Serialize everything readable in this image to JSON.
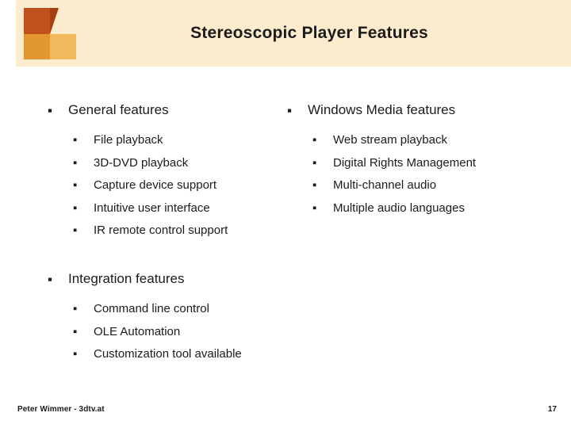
{
  "slide": {
    "title": "Stereoscopic Player Features",
    "sections": [
      {
        "heading": "General features",
        "items": [
          "File playback",
          "3D-DVD playback",
          "Capture device support",
          "Intuitive user interface",
          "IR remote control support"
        ]
      },
      {
        "heading": "Windows Media features",
        "items": [
          "Web stream playback",
          "Digital Rights Management",
          "Multi-channel audio",
          "Multiple audio languages"
        ]
      },
      {
        "heading": "Integration features",
        "items": [
          "Command line control",
          "OLE Automation",
          "Customization tool available"
        ]
      }
    ],
    "bullet_glyph": "▪",
    "footer": {
      "author": "Peter Wimmer - 3dtv.at",
      "page_number": "17"
    },
    "colors": {
      "header_band": "#fdebcd",
      "cube_dark": "#c0501d",
      "cube_mid": "#e2962f",
      "cube_light": "#f2b95c",
      "text": "#1b1b1b"
    }
  }
}
